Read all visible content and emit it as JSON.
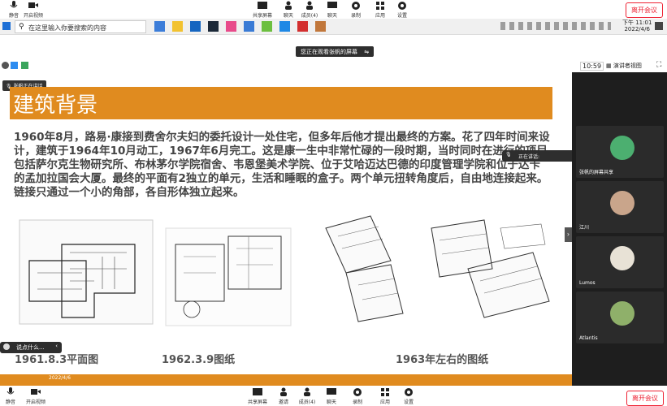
{
  "top_controls": {
    "mute": "静音",
    "start_video": "开启视频",
    "share_screen": "共享屏幕",
    "chat": "聊天",
    "participants": "成员(4)",
    "react": "聊天",
    "record": "录制",
    "apps": "应用",
    "settings": "设置",
    "leave": "离开会议"
  },
  "taskbar": {
    "search_placeholder": "在这里输入你要搜索的内容",
    "time": "下午 11:01",
    "date": "2022/4/6"
  },
  "viewing_banner": "您正在观看张帆的屏幕",
  "status_bar": {
    "time": "10:59",
    "view_label": "演讲者视图"
  },
  "slide": {
    "tag": "张帆正在讲话",
    "title": "建筑背景",
    "body": "1960年8月，路易·康接到费舍尔夫妇的委托设计一处住宅，但多年后他才提出最终的方案。花了四年时间来设计，建筑于1964年10月动工，1967年6月完工。这是康一生中非常忙碌的一段时期，当时同时在进行的项目包括萨尔克生物研究所、布林茅尔学院宿舍、韦恩堡美术学院、位于艾哈迈达巴德的印度管理学院和位于达卡的孟加拉国会大厦。最终的平面有2独立的单元，生活和睡眠的盒子。两个单元扭转角度后，自由地连接起来。链接只通过一个小的角部，各自形体独立起来。",
    "captions": [
      "1961.8.3平面图",
      "1962.3.9图纸",
      "1963年左右的图纸"
    ],
    "footer_text": "2022/4/6"
  },
  "speaking_popup": "正在讲话:",
  "chat_input": "说点什么...",
  "participants": [
    {
      "name": "张帆的屏幕共享"
    },
    {
      "name": "江川"
    },
    {
      "name": "Lumos"
    },
    {
      "name": "Atlantis"
    }
  ],
  "bottom_controls": {
    "mute": "静音",
    "start_video": "开启视频",
    "share_screen": "共享屏幕",
    "chat": "邀请",
    "participants": "成员(4)",
    "chat2": "聊天",
    "record": "录制",
    "apps": "应用",
    "settings": "设置",
    "leave": "离开会议"
  },
  "colors": {
    "accent_orange": "#e08b1f",
    "leave_red": "#e23",
    "gallery_bg": "#1e1e1e"
  }
}
